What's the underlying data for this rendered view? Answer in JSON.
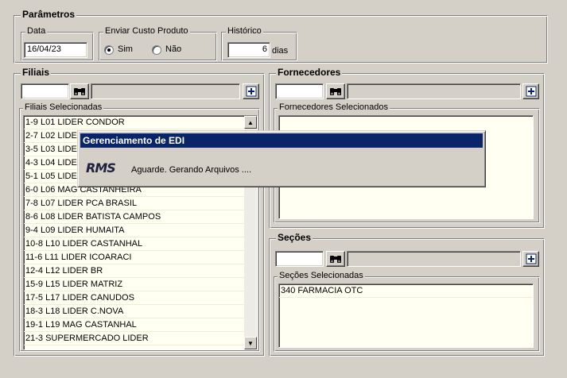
{
  "parametros": {
    "title": "Parâmetros",
    "data": {
      "label": "Data",
      "value": "16/04/23"
    },
    "custo": {
      "label": "Enviar Custo Produto",
      "opt_sim": "Sim",
      "opt_nao": "Não",
      "selected": "Sim"
    },
    "historico": {
      "label": "Histórico",
      "value": "6",
      "unit": "dias"
    }
  },
  "filiais": {
    "title": "Filiais",
    "search_value": "",
    "list_title": "Filiais Selecionadas",
    "items": [
      "1-9 L01 LIDER CONDOR",
      "2-7 L02 LIDER",
      "3-5 L03 LIDER",
      "4-3 L04 LIDER",
      "5-1 L05 LIDER",
      "6-0 L06 MAG CASTANHEIRA",
      "7-8 L07 LIDER PCA BRASIL",
      "8-6 L08 LIDER BATISTA CAMPOS",
      "9-4 L09 LIDER HUMAITA",
      "10-8 L10 LIDER CASTANHAL",
      "11-6 L11 LIDER ICOARACI",
      "12-4 L12 LIDER BR",
      "15-9 L15 LIDER MATRIZ",
      "17-5 L17 LIDER CANUDOS",
      "18-3 L18 LIDER C.NOVA",
      "19-1 L19 MAG CASTANHAL",
      "21-3 SUPERMERCADO LIDER"
    ]
  },
  "fornecedores": {
    "title": "Fornecedores",
    "list_title": "Fornecedores Selecionados",
    "items": []
  },
  "secoes": {
    "title": "Seções",
    "list_title": "Seções Selecionadas",
    "items": [
      "340 FARMACIA OTC"
    ]
  },
  "dialog": {
    "title": "Gerenciamento de EDI",
    "logo": "RMS",
    "message": "Aguarde. Gerando Arquivos ...."
  },
  "colors": {
    "titlebar": "#0a246a",
    "window": "#d4d0c8",
    "list_bg": "#fffff2"
  },
  "icons": {
    "search": "binoculars-icon",
    "add": "add-icon"
  }
}
